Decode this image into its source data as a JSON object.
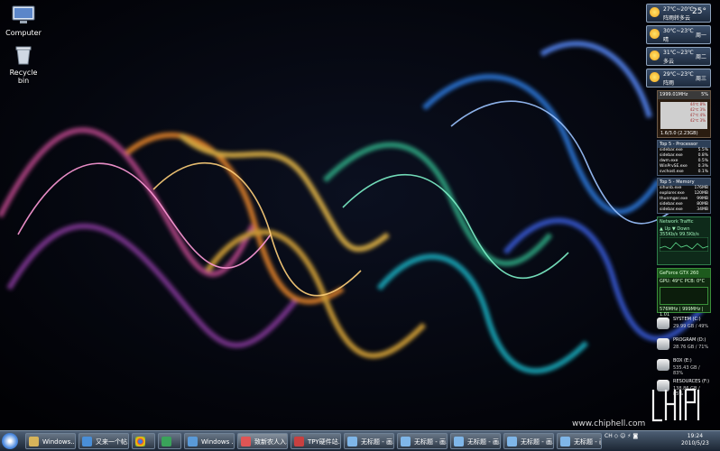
{
  "desktop": {
    "icons": [
      {
        "label": "Computer",
        "icon": "computer-icon"
      },
      {
        "label": "Recycle bin",
        "icon": "recycle-bin-icon"
      }
    ],
    "watermark": "www.chiphell.com",
    "logo_text": "chip hell"
  },
  "weather": [
    {
      "range": "27℃~20℃",
      "condition": "阵雨转多云",
      "day": "25°"
    },
    {
      "range": "30℃~23℃",
      "condition": "晴",
      "day": "周一"
    },
    {
      "range": "31℃~23℃",
      "condition": "多云",
      "day": "周二"
    },
    {
      "range": "29℃~23℃",
      "condition": "阵雨",
      "day": "周三"
    }
  ],
  "cpu": {
    "freq": "1999.01MHz",
    "pct": "5%",
    "cores": [
      "44℃ 8%",
      "42℃ 3%",
      "47℃ 4%",
      "42℃ 3%"
    ],
    "footer": "1.6/3.0 (2.23GB)"
  },
  "processes": {
    "title": "Top 5 - Processor",
    "rows": [
      {
        "name": "sidebar.exe",
        "val": "5.5%"
      },
      {
        "name": "sidebar.exe",
        "val": "0.8%"
      },
      {
        "name": "dwm.exe",
        "val": "0.5%"
      },
      {
        "name": "WinPrvSE.exe",
        "val": "0.3%"
      },
      {
        "name": "svchost.exe",
        "val": "0.1%"
      }
    ]
  },
  "memory": {
    "title": "Top 5 - Memory",
    "rows": [
      {
        "name": "sihunb.exe",
        "val": "176MB"
      },
      {
        "name": "explorer.exe",
        "val": "120MB"
      },
      {
        "name": "thunmger.exe",
        "val": "99MB"
      },
      {
        "name": "sidebar.exe",
        "val": "80MB"
      },
      {
        "name": "sidebar.exe",
        "val": "34MB"
      }
    ]
  },
  "network": {
    "title": "Network Traffic",
    "up_label": "Up",
    "down_label": "Down",
    "up_val": "355Kb/s",
    "down_val": "99.5Kb/s"
  },
  "gpu": {
    "title": "GeForce GTX 260",
    "temps": "GPU: 49°C PCB: 0°C",
    "footer": "576MHz | 999MHz | 1.01"
  },
  "drives": [
    {
      "name": "SYSTEM (C:)",
      "stats": "29.99 GB / 49%"
    },
    {
      "name": "PROGRAM (D:)",
      "stats": "28.76 GB / 71%"
    },
    {
      "name": "BOX (E:)",
      "stats": "535.43 GB / 83%"
    },
    {
      "name": "RESOURCES (F:)",
      "stats": "138.86 GB / 85%"
    }
  ],
  "taskbar": {
    "buttons": [
      {
        "label": "Windows...",
        "active": false
      },
      {
        "label": "又来一个帖...",
        "active": false
      },
      {
        "label": "",
        "active": false
      },
      {
        "label": "",
        "active": false
      },
      {
        "label": "Windows ...",
        "active": false
      },
      {
        "label": "致新农人入...",
        "active": true
      },
      {
        "label": "TPY硬件站...",
        "active": false
      },
      {
        "label": "无标题 - 画...",
        "active": false
      },
      {
        "label": "无标题 - 画...",
        "active": false
      },
      {
        "label": "无标题 - 画...",
        "active": false
      },
      {
        "label": "无标题 - 画...",
        "active": false
      },
      {
        "label": "无标题 - 画...",
        "active": false
      }
    ],
    "tray_text": "CH ◇ ☺ ⚡ ◙",
    "time": "19:24",
    "date": "2010/5/23"
  }
}
